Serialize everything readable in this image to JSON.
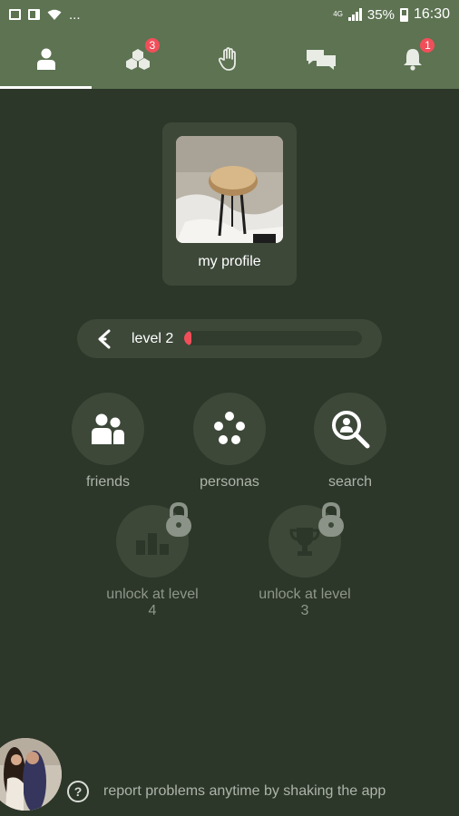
{
  "status_bar": {
    "overflow": "...",
    "network": "4G",
    "battery": "35%",
    "time": "16:30"
  },
  "nav": {
    "tabs": [
      {
        "icon": "person-icon",
        "badge": null,
        "active": true
      },
      {
        "icon": "cubes-icon",
        "badge": "3",
        "active": false
      },
      {
        "icon": "hand-icon",
        "badge": null,
        "active": false
      },
      {
        "icon": "chat-icon",
        "badge": null,
        "active": false
      },
      {
        "icon": "bell-icon",
        "badge": "1",
        "active": false
      }
    ]
  },
  "profile": {
    "label": "my profile",
    "photo": "photo of a wooden stool"
  },
  "level": {
    "label": "level 2",
    "progress": 0.02
  },
  "features": {
    "friends": "friends",
    "personas": "personas",
    "search": "search",
    "locked_1": "unlock at level 4",
    "locked_2": "unlock at level 3"
  },
  "footer": {
    "help": "?",
    "text": "report problems anytime by shaking the app"
  },
  "colors": {
    "bar": "#5d7352",
    "background": "#2c3629",
    "surface": "#3d4839",
    "accent": "#f04f5a"
  }
}
